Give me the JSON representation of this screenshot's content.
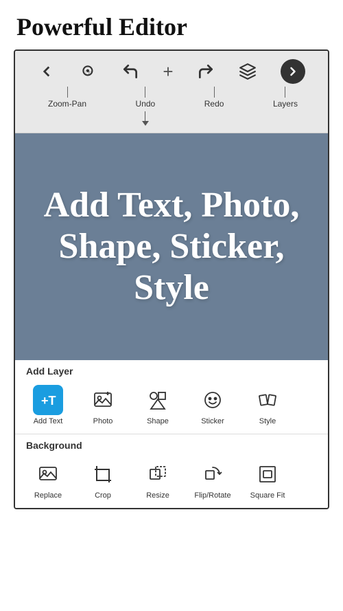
{
  "header": {
    "title": "Powerful Editor"
  },
  "toolbar": {
    "icons": [
      {
        "name": "back-icon",
        "symbol": "←",
        "label": null
      },
      {
        "name": "zoom-pan-icon",
        "symbol": "✋",
        "label": "Zoom-Pan"
      },
      {
        "name": "undo-icon",
        "symbol": "↺",
        "label": "Undo"
      },
      {
        "name": "add-icon",
        "symbol": "+",
        "label": null
      },
      {
        "name": "redo-icon",
        "symbol": "↻",
        "label": "Redo"
      },
      {
        "name": "layers-icon",
        "symbol": "⬡",
        "label": "Layers"
      },
      {
        "name": "next-icon",
        "symbol": "→",
        "label": null,
        "active": true
      }
    ]
  },
  "canvas": {
    "text": "Add Text, Photo, Shape, Sticker, Style"
  },
  "add_layer_section": {
    "header": "Add Layer",
    "tools": [
      {
        "name": "add-text-tool",
        "label": "Add Text",
        "active": true
      },
      {
        "name": "photo-tool",
        "label": "Photo",
        "active": false
      },
      {
        "name": "shape-tool",
        "label": "Shape",
        "active": false
      },
      {
        "name": "sticker-tool",
        "label": "Sticker",
        "active": false
      },
      {
        "name": "style-tool",
        "label": "Style",
        "active": false
      }
    ]
  },
  "background_section": {
    "header": "Background",
    "tools": [
      {
        "name": "replace-tool",
        "label": "Replace",
        "active": false
      },
      {
        "name": "crop-tool",
        "label": "Crop",
        "active": false
      },
      {
        "name": "resize-tool",
        "label": "Resize",
        "active": false
      },
      {
        "name": "flip-rotate-tool",
        "label": "Flip/Rotate",
        "active": false
      },
      {
        "name": "square-fit-tool",
        "label": "Square Fit",
        "active": false
      }
    ]
  }
}
